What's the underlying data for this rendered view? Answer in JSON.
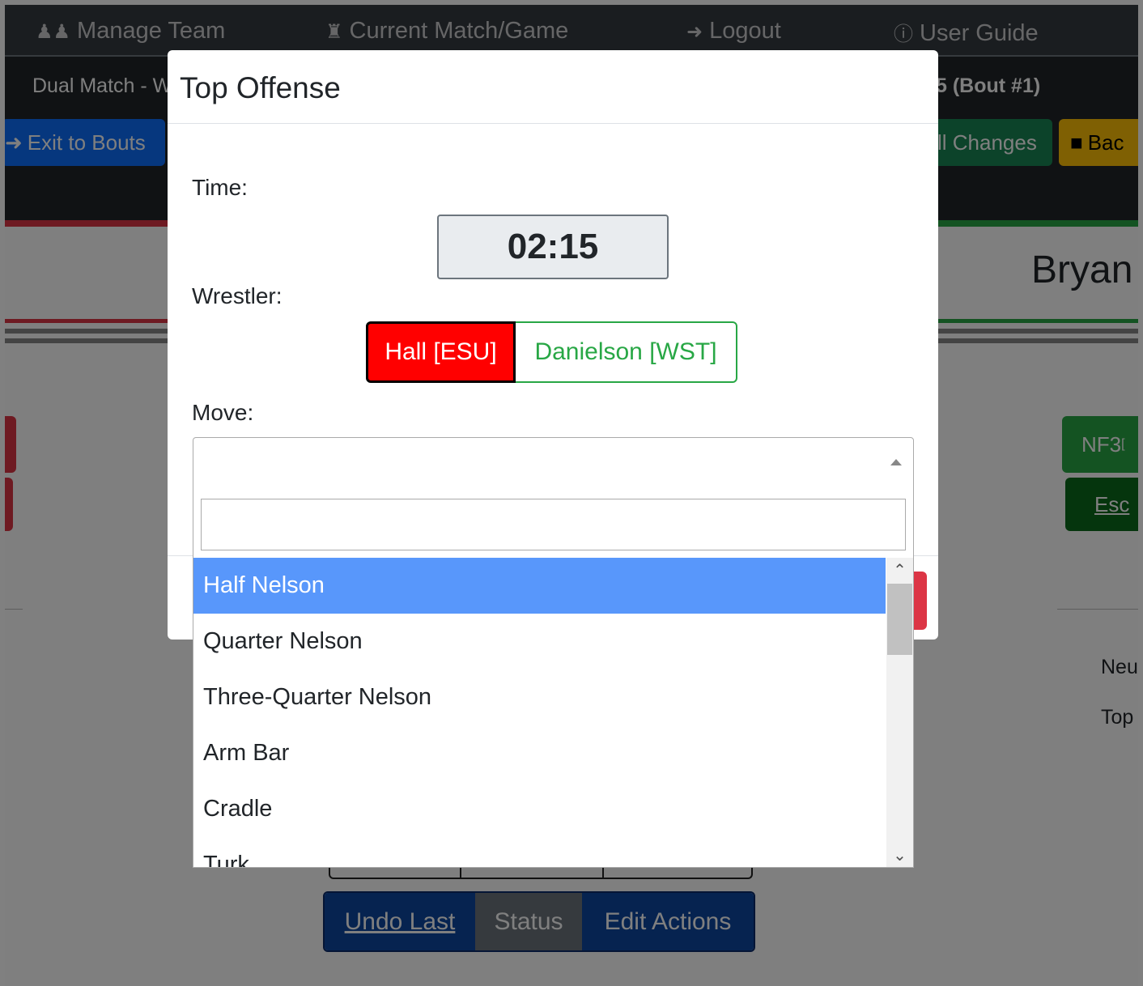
{
  "nav": {
    "manage_team": "Manage Team",
    "current_match": "Current Match/Game",
    "logout": "Logout",
    "user_guide": "User Guide"
  },
  "match_bar": {
    "title_left": "Dual Match - W",
    "title_right": "5 (Bout #1)"
  },
  "action_bar": {
    "exit_bouts": "Exit to Bouts",
    "save_changes": "ll Changes",
    "back": "Bac"
  },
  "background": {
    "wrestler_name": "Bryan",
    "nf3": "NF3",
    "nf3_sup": "[",
    "escape": "Esc",
    "neutral": "Neu",
    "top": "Top",
    "undo_last": "Undo Last",
    "status": "Status",
    "edit_actions": "Edit Actions"
  },
  "modal": {
    "title": "Top Offense",
    "time_label": "Time:",
    "time_value": "02:15",
    "wrestler_label": "Wrestler:",
    "wrestler_red": "Hall [ESU]",
    "wrestler_green": "Danielson [WST]",
    "move_label": "Move:"
  },
  "move_dropdown": {
    "search_value": "",
    "options": [
      "Half Nelson",
      "Quarter Nelson",
      "Three-Quarter Nelson",
      "Arm Bar",
      "Cradle",
      "Turk"
    ],
    "highlighted": "Half Nelson"
  },
  "colors": {
    "highlight": "#5897fb",
    "red": "#ff0000",
    "green": "#28a745",
    "primary": "#0d47a1"
  }
}
